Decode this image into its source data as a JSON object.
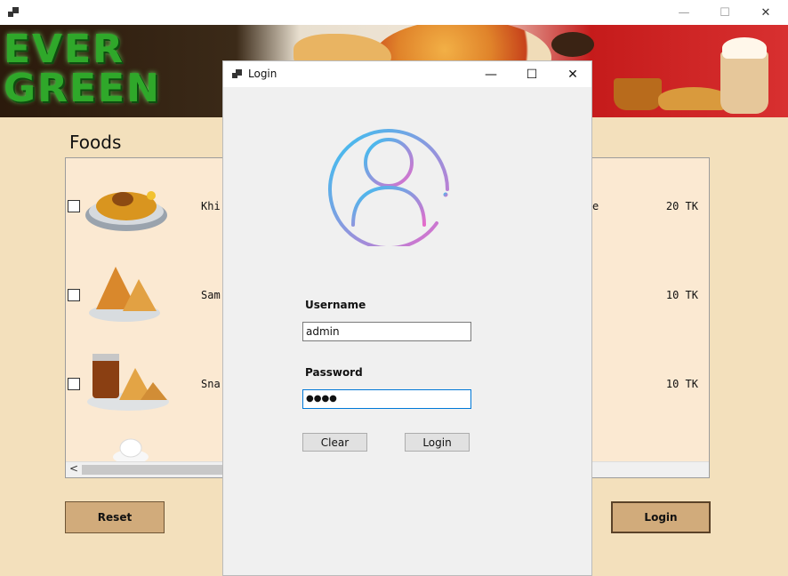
{
  "main_window": {
    "minimize_label": "—",
    "maximize_label": "☐",
    "close_label": "✕"
  },
  "banner": {
    "logo_line1": "EVER",
    "logo_line2": "GREEN"
  },
  "foods": {
    "title": "Foods",
    "items": [
      {
        "name": "Khi",
        "price": "20 TK",
        "checked": false
      },
      {
        "name": "Sam",
        "price": "10 TK",
        "checked": false
      },
      {
        "name": "Sna",
        "price": "10 TK",
        "checked": false
      }
    ],
    "hidden_column_fragment": "e",
    "scroll_left_label": "<"
  },
  "buttons": {
    "reset_label": "Reset",
    "login_label": "Login"
  },
  "login_dialog": {
    "title": "Login",
    "minimize_label": "—",
    "maximize_label": "☐",
    "close_label": "✕",
    "username_label": "Username",
    "username_value": "admin",
    "password_label": "Password",
    "password_value": "●●●●",
    "clear_label": "Clear",
    "login_label": "Login"
  },
  "colors": {
    "background": "#f3e0bc",
    "button_brown": "#d1ab7b",
    "avatar_gradient_start": "#34c4f2",
    "avatar_gradient_end": "#e56aca",
    "focus_border": "#0078d7"
  }
}
